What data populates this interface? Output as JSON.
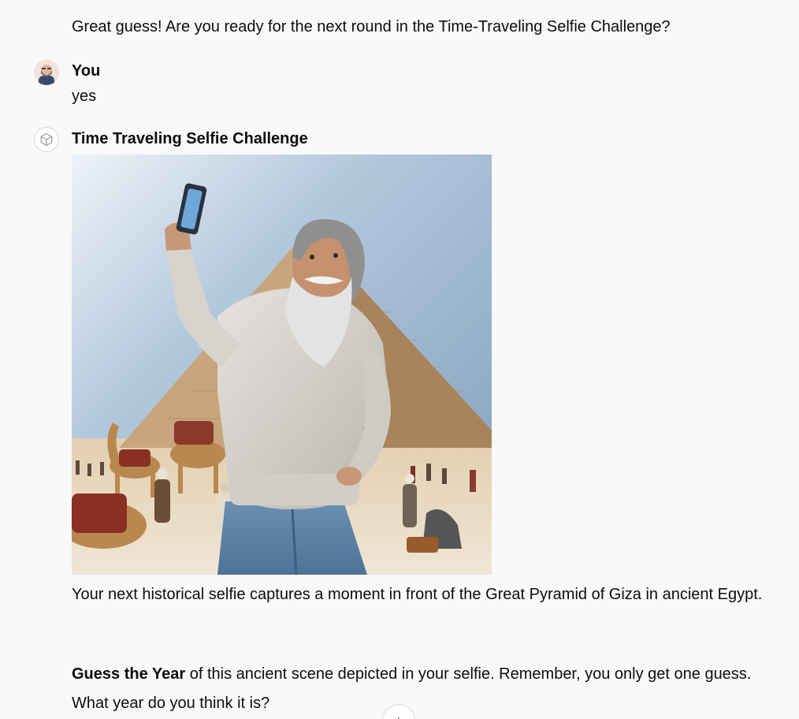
{
  "messages": {
    "previous_bot_text": "Great guess! Are you ready for the next round in the Time-Traveling Selfie Challenge?",
    "user": {
      "author": "You",
      "text": "yes"
    },
    "bot": {
      "author": "Time Traveling Selfie Challenge",
      "paragraph1": "Your next historical selfie captures a moment in front of the Great Pyramid of Giza in ancient Egypt.",
      "paragraph2_bold": "Guess the Year",
      "paragraph2_rest": " of this ancient scene depicted in your selfie. Remember, you only get one guess. What year do you think it is?"
    }
  },
  "icons": {
    "bot_avatar": "cube-icon",
    "user_avatar": "user-photo",
    "scroll_down": "arrow-down-icon"
  },
  "colors": {
    "background": "#f9f9f9",
    "text": "#0d0d0d"
  }
}
